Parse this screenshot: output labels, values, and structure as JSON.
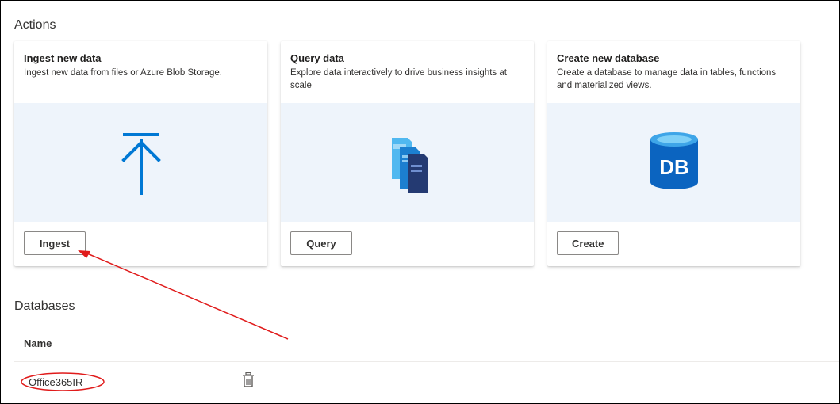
{
  "actions": {
    "title": "Actions",
    "cards": [
      {
        "title": "Ingest new data",
        "description": "Ingest new data from files or Azure Blob Storage.",
        "button": "Ingest",
        "icon": "upload-arrow-icon"
      },
      {
        "title": "Query data",
        "description": "Explore data interactively to drive business insights at scale",
        "button": "Query",
        "icon": "query-documents-icon"
      },
      {
        "title": "Create new database",
        "description": "Create a database to manage data in tables, functions and materialized views.",
        "button": "Create",
        "icon": "database-icon",
        "icon_text": "DB"
      }
    ]
  },
  "databases": {
    "title": "Databases",
    "column_name": "Name",
    "rows": [
      {
        "name": "Office365IR",
        "action_icon": "delete-icon"
      }
    ]
  },
  "annotation": {
    "arrow_color": "#e01b1b",
    "highlight_color": "#e01b1b"
  },
  "colors": {
    "accent": "#0078d4",
    "media_background": "#eef4fb"
  }
}
